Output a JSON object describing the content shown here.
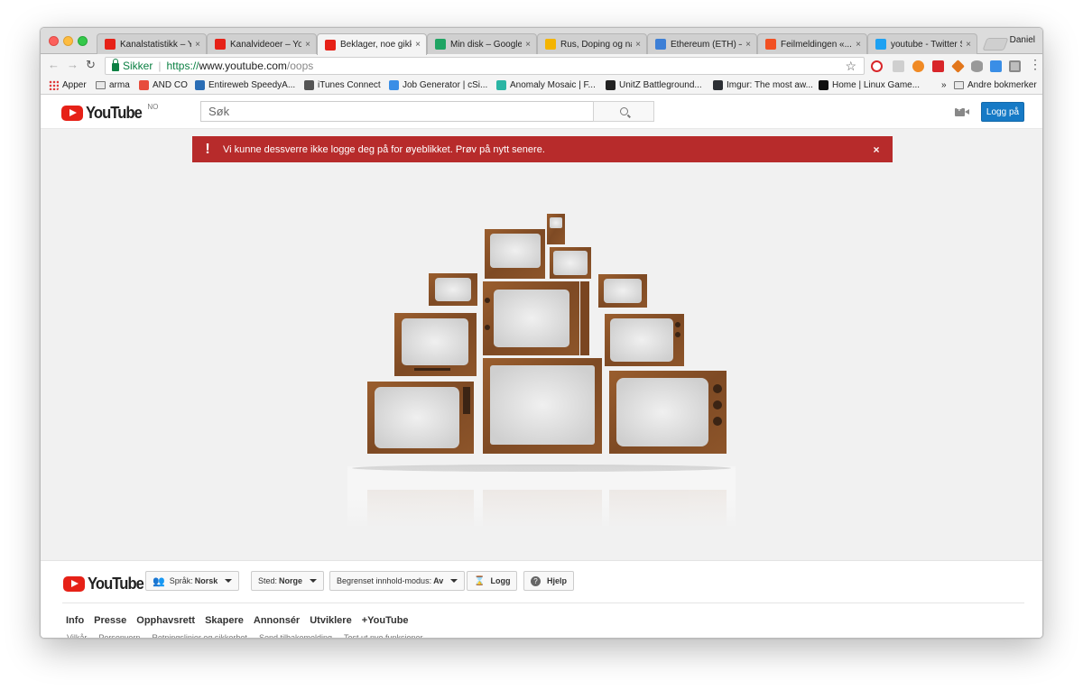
{
  "browser": {
    "tabs": [
      {
        "title": "Kanalstatistikk – YouTube",
        "favicon_color": "#e62117"
      },
      {
        "title": "Kanalvideoer – YouTube",
        "favicon_color": "#e62117"
      },
      {
        "title": "Beklager, noe gikk galt",
        "favicon_color": "#e62117",
        "active": true
      },
      {
        "title": "Min disk – Google Disk",
        "favicon_color": "#1fa463"
      },
      {
        "title": "Rus, Doping og narkotika",
        "favicon_color": "#f4b400"
      },
      {
        "title": "Ethereum (ETH) – Price",
        "favicon_color": "#3d7fd6"
      },
      {
        "title": "Feilmeldingen «...»",
        "favicon_color": "#f25022"
      },
      {
        "title": "youtube - Twitter Search",
        "favicon_color": "#1da1f2"
      }
    ],
    "profile_name": "Daniel",
    "secure_label": "Sikker",
    "url_scheme": "https://",
    "url_host": "www.youtube.com",
    "url_path": "/oops",
    "bookmarks": [
      {
        "label": "Apper",
        "icon": "apps-grid-icon"
      },
      {
        "label": "arma",
        "icon": "folder-icon"
      },
      {
        "label": "AND CO",
        "icon": "andco-icon",
        "color": "#e74c3c"
      },
      {
        "label": "Entireweb SpeedyA...",
        "icon": "entireweb-icon",
        "color": "#2a6db5"
      },
      {
        "label": "iTunes Connect",
        "icon": "apple-icon",
        "color": "#555555"
      },
      {
        "label": "Job Generator | cSi...",
        "icon": "cloud-icon",
        "color": "#3a8ee6"
      },
      {
        "label": "Anomaly Mosaic | F...",
        "icon": "fb-icon",
        "color": "#2bb5a4"
      },
      {
        "label": "UnitZ Battleground...",
        "icon": "unity-icon",
        "color": "#222222"
      },
      {
        "label": "Imgur: The most aw...",
        "icon": "imgur-icon",
        "color": "#2c2f34"
      },
      {
        "label": "Home | Linux Game...",
        "icon": "linux-icon",
        "color": "#111111"
      }
    ],
    "bookmarks_more": "»",
    "other_bookmarks": "Andre bokmerker"
  },
  "header": {
    "logo_text": "YouTube",
    "country_code": "NO",
    "search_placeholder": "Søk",
    "login_label": "Logg på"
  },
  "alert": {
    "message": "Vi kunne dessverre ikke logge deg på for øyeblikket. Prøv på nytt senere.",
    "color": "#b72b2b"
  },
  "footer": {
    "logo_text": "YouTube",
    "language_label": "Språk:",
    "language_value": "Norsk",
    "location_label": "Sted:",
    "location_value": "Norge",
    "restricted_label": "Begrenset innhold-modus:",
    "restricted_value": "Av",
    "history_label": "Logg",
    "help_label": "Hjelp",
    "links": [
      "Info",
      "Presse",
      "Opphavsrett",
      "Skapere",
      "Annonsér",
      "Utviklere",
      "+YouTube"
    ],
    "sublinks": [
      "Vilkår",
      "Personvern",
      "Retningslinjer og sikkerhet",
      "Send tilbakemelding",
      "Test ut nye funksjoner"
    ]
  },
  "colors": {
    "brand_red": "#e62117",
    "login_blue": "#167ac6",
    "tv_wood": "#8a5128"
  }
}
